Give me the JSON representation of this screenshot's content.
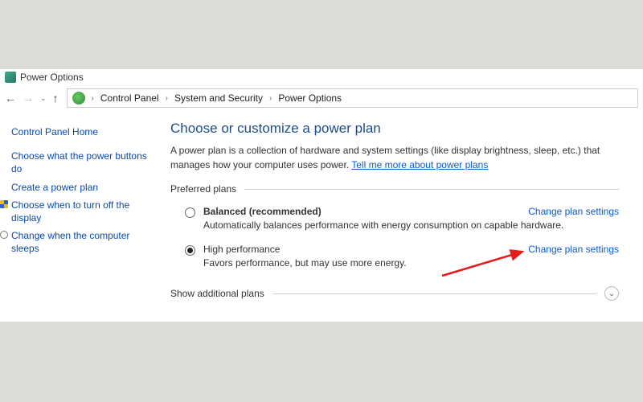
{
  "window": {
    "title": "Power Options"
  },
  "breadcrumb": {
    "items": [
      "Control Panel",
      "System and Security",
      "Power Options"
    ]
  },
  "sidebar": {
    "home": "Control Panel Home",
    "links": [
      "Choose what the power buttons do",
      "Create a power plan",
      "Choose when to turn off the display",
      "Change when the computer sleeps"
    ]
  },
  "main": {
    "heading": "Choose or customize a power plan",
    "intro_prefix": "A power plan is a collection of hardware and system settings (like display brightness, sleep, etc.) that manages how your computer uses power. ",
    "intro_link": "Tell me more about power plans",
    "preferred_label": "Preferred plans",
    "plans": [
      {
        "name": "Balanced (recommended)",
        "desc": "Automatically balances performance with energy consumption on capable hardware.",
        "selected": false,
        "change": "Change plan settings"
      },
      {
        "name": "High performance",
        "desc": "Favors performance, but may use more energy.",
        "selected": true,
        "change": "Change plan settings"
      }
    ],
    "show_additional": "Show additional plans"
  }
}
